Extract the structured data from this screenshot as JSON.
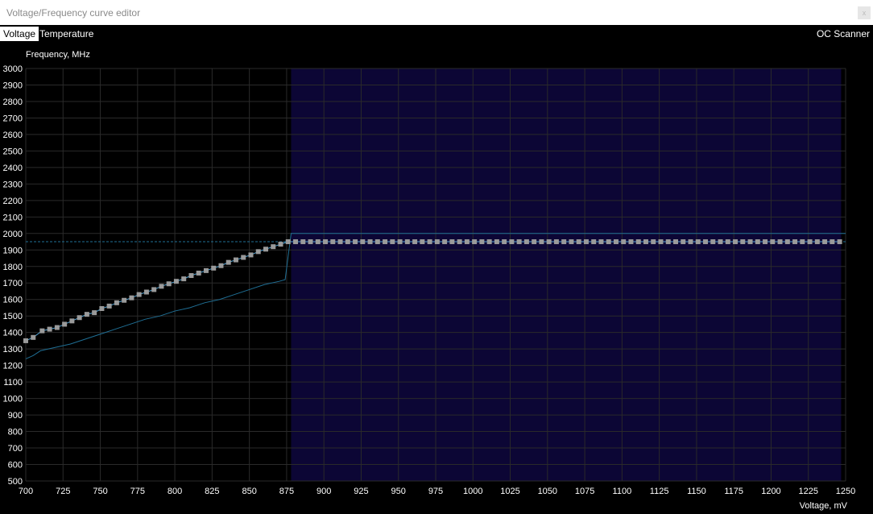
{
  "window": {
    "title": "Voltage/Frequency curve editor",
    "close_label": "x"
  },
  "tabs": [
    {
      "label": "Voltage",
      "active": true
    },
    {
      "label": "Temperature",
      "active": false
    }
  ],
  "oc_scanner_label": "OC Scanner",
  "colors": {
    "background": "#000000",
    "shaded_region": "#0c0635",
    "grid": "#2a2a2a",
    "curve_line": "#4fa2d4",
    "point_fill": "#9a9a9a",
    "reference_line": "#1f6f95"
  },
  "chart_data": {
    "type": "line",
    "title": "",
    "xlabel": "Voltage, mV",
    "ylabel": "Frequency, MHz",
    "xlim": [
      700,
      1250
    ],
    "ylim": [
      500,
      3000
    ],
    "x_ticks": [
      700,
      725,
      750,
      775,
      800,
      825,
      850,
      875,
      900,
      925,
      950,
      975,
      1000,
      1025,
      1050,
      1075,
      1100,
      1125,
      1150,
      1175,
      1200,
      1225,
      1250
    ],
    "y_ticks": [
      500,
      600,
      700,
      800,
      900,
      1000,
      1100,
      1200,
      1300,
      1400,
      1500,
      1600,
      1700,
      1800,
      1900,
      2000,
      2100,
      2200,
      2300,
      2400,
      2500,
      2600,
      2700,
      2800,
      2900,
      3000
    ],
    "grid": true,
    "shaded_region_x": [
      878,
      1247
    ],
    "series": [
      {
        "points": [
          [
            700,
            1350
          ],
          [
            705,
            1370
          ],
          [
            711,
            1410
          ],
          [
            716,
            1420
          ],
          [
            721,
            1430
          ],
          [
            726,
            1450
          ],
          [
            731,
            1470
          ],
          [
            736,
            1490
          ],
          [
            741,
            1510
          ],
          [
            746,
            1520
          ],
          [
            751,
            1545
          ],
          [
            756,
            1560
          ],
          [
            761,
            1580
          ],
          [
            766,
            1595
          ],
          [
            771,
            1610
          ],
          [
            776,
            1630
          ],
          [
            781,
            1645
          ],
          [
            786,
            1660
          ],
          [
            791,
            1680
          ],
          [
            796,
            1695
          ],
          [
            801,
            1710
          ],
          [
            806,
            1725
          ],
          [
            811,
            1745
          ],
          [
            816,
            1760
          ],
          [
            821,
            1775
          ],
          [
            826,
            1790
          ],
          [
            831,
            1805
          ],
          [
            836,
            1825
          ],
          [
            841,
            1840
          ],
          [
            846,
            1855
          ],
          [
            851,
            1870
          ],
          [
            856,
            1890
          ],
          [
            861,
            1905
          ],
          [
            866,
            1920
          ],
          [
            871,
            1935
          ],
          [
            876,
            1950
          ],
          [
            881,
            1950
          ],
          [
            886,
            1950
          ],
          [
            891,
            1950
          ],
          [
            896,
            1950
          ],
          [
            901,
            1950
          ],
          [
            906,
            1950
          ],
          [
            911,
            1950
          ],
          [
            916,
            1950
          ],
          [
            921,
            1950
          ],
          [
            926,
            1950
          ],
          [
            931,
            1950
          ],
          [
            936,
            1950
          ],
          [
            941,
            1950
          ],
          [
            946,
            1950
          ],
          [
            951,
            1950
          ],
          [
            956,
            1950
          ],
          [
            961,
            1950
          ],
          [
            966,
            1950
          ],
          [
            971,
            1950
          ],
          [
            976,
            1950
          ],
          [
            981,
            1950
          ],
          [
            986,
            1950
          ],
          [
            991,
            1950
          ],
          [
            996,
            1950
          ],
          [
            1001,
            1950
          ],
          [
            1006,
            1950
          ],
          [
            1011,
            1950
          ],
          [
            1016,
            1950
          ],
          [
            1021,
            1950
          ],
          [
            1026,
            1950
          ],
          [
            1031,
            1950
          ],
          [
            1036,
            1950
          ],
          [
            1041,
            1950
          ],
          [
            1046,
            1950
          ],
          [
            1051,
            1950
          ],
          [
            1056,
            1950
          ],
          [
            1061,
            1950
          ],
          [
            1066,
            1950
          ],
          [
            1071,
            1950
          ],
          [
            1076,
            1950
          ],
          [
            1081,
            1950
          ],
          [
            1086,
            1950
          ],
          [
            1091,
            1950
          ],
          [
            1096,
            1950
          ],
          [
            1101,
            1950
          ],
          [
            1106,
            1950
          ],
          [
            1111,
            1950
          ],
          [
            1116,
            1950
          ],
          [
            1121,
            1950
          ],
          [
            1126,
            1950
          ],
          [
            1131,
            1950
          ],
          [
            1136,
            1950
          ],
          [
            1141,
            1950
          ],
          [
            1146,
            1950
          ],
          [
            1151,
            1950
          ],
          [
            1156,
            1950
          ],
          [
            1161,
            1950
          ],
          [
            1166,
            1950
          ],
          [
            1171,
            1950
          ],
          [
            1176,
            1950
          ],
          [
            1181,
            1950
          ],
          [
            1186,
            1950
          ],
          [
            1191,
            1950
          ],
          [
            1196,
            1950
          ],
          [
            1201,
            1950
          ],
          [
            1206,
            1950
          ],
          [
            1211,
            1950
          ],
          [
            1216,
            1950
          ],
          [
            1221,
            1950
          ],
          [
            1226,
            1950
          ],
          [
            1231,
            1950
          ],
          [
            1236,
            1950
          ],
          [
            1241,
            1950
          ],
          [
            1246,
            1950
          ]
        ]
      },
      {
        "points": [
          [
            700,
            1240
          ],
          [
            705,
            1260
          ],
          [
            710,
            1290
          ],
          [
            720,
            1310
          ],
          [
            730,
            1330
          ],
          [
            740,
            1360
          ],
          [
            750,
            1390
          ],
          [
            760,
            1420
          ],
          [
            770,
            1450
          ],
          [
            780,
            1480
          ],
          [
            790,
            1500
          ],
          [
            800,
            1530
          ],
          [
            810,
            1550
          ],
          [
            820,
            1580
          ],
          [
            830,
            1600
          ],
          [
            840,
            1630
          ],
          [
            850,
            1660
          ],
          [
            860,
            1690
          ],
          [
            870,
            1710
          ],
          [
            874,
            1720
          ],
          [
            878,
            2000
          ],
          [
            1250,
            2000
          ]
        ]
      }
    ],
    "reference_line_y": 1950
  }
}
